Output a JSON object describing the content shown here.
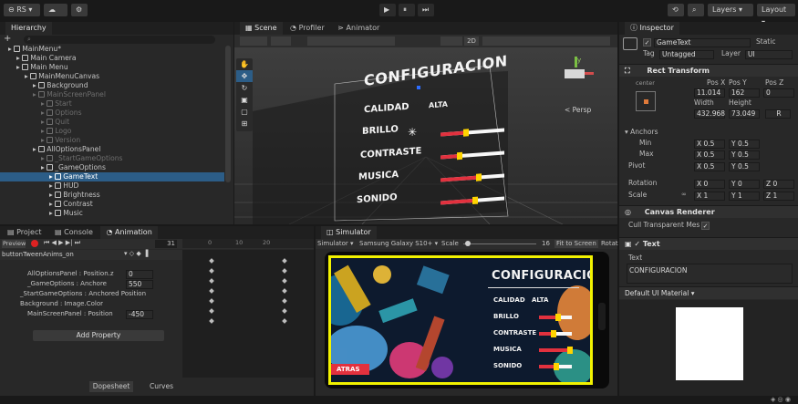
{
  "toolbar": {
    "account": "RS",
    "cloud": "☁",
    "gear": "⚙",
    "play": "▶",
    "pause": "⏸",
    "step": "⏭",
    "history": "⟲",
    "search": "🔍",
    "layers": "Layers",
    "layout": "Layout"
  },
  "hierarchy": {
    "title": "Hierarchy",
    "add": "+",
    "search_placeholder": "All",
    "rows": [
      {
        "label": "MainMenu*",
        "indent": 1,
        "state": "scene"
      },
      {
        "label": "Main Camera",
        "indent": 2,
        "state": "normal"
      },
      {
        "label": "Main Menu",
        "indent": 2,
        "state": "normal"
      },
      {
        "label": "MainMenuCanvas",
        "indent": 3,
        "state": "normal"
      },
      {
        "label": "Background",
        "indent": 4,
        "state": "normal"
      },
      {
        "label": "MainScreenPanel",
        "indent": 4,
        "state": "dim"
      },
      {
        "label": "Start",
        "indent": 5,
        "state": "dim"
      },
      {
        "label": "Options",
        "indent": 5,
        "state": "dim"
      },
      {
        "label": "Quit",
        "indent": 5,
        "state": "dim"
      },
      {
        "label": "Logo",
        "indent": 5,
        "state": "dim"
      },
      {
        "label": "Version",
        "indent": 5,
        "state": "dim"
      },
      {
        "label": "AllOptionsPanel",
        "indent": 4,
        "state": "normal"
      },
      {
        "label": "_StartGameOptions",
        "indent": 5,
        "state": "dim"
      },
      {
        "label": "_GameOptions",
        "indent": 5,
        "state": "normal"
      },
      {
        "label": "GameText",
        "indent": 6,
        "state": "sel"
      },
      {
        "label": "HUD",
        "indent": 6,
        "state": "normal"
      },
      {
        "label": "Brightness",
        "indent": 6,
        "state": "normal"
      },
      {
        "label": "Contrast",
        "indent": 6,
        "state": "normal"
      },
      {
        "label": "Music",
        "indent": 6,
        "state": "normal"
      }
    ]
  },
  "scene": {
    "tabs": [
      "Scene",
      "Profiler",
      "Animator"
    ],
    "mode_2d": "2D",
    "persp": "< Persp",
    "axis_y": "y",
    "axis_x": "x",
    "menu_title": "CONFIGURACION",
    "items": [
      {
        "label": "CALIDAD",
        "value": "ALTA"
      },
      {
        "label": "BRILLO",
        "value": ""
      },
      {
        "label": "CONTRASTE",
        "value": ""
      },
      {
        "label": "MUSICA",
        "value": ""
      },
      {
        "label": "SONIDO",
        "value": ""
      }
    ]
  },
  "bottom_left": {
    "tabs": [
      "Project",
      "Console",
      "Animation"
    ],
    "preview": "Preview",
    "frame": "31",
    "clip": "buttonTweenAnims_on",
    "ruler": [
      "0",
      "10",
      "20"
    ],
    "properties": [
      {
        "label": "AllOptionsPanel : Position.z",
        "value": "0"
      },
      {
        "label": "_GameOptions : Anchore",
        "value": "550"
      },
      {
        "label": "_StartGameOptions : Anchored Position",
        "value": ""
      },
      {
        "label": "Background : Image.Color",
        "value": ""
      },
      {
        "label": "MainScreenPanel : Position",
        "value": "-450"
      }
    ],
    "add_property": "Add Property",
    "dopesheet": "Dopesheet",
    "curves": "Curves"
  },
  "simulator": {
    "tab": "Simulator",
    "mode": "Simulator",
    "device": "Samsung Galaxy S10+",
    "scale_label": "Scale",
    "scale_value": "16",
    "fit": "Fit to Screen",
    "rotate": "Rotat",
    "menu_title": "CONFIGURACION",
    "items": [
      {
        "label": "CALIDAD",
        "value": "ALTA",
        "level": 0
      },
      {
        "label": "BRILLO",
        "value": "",
        "level": 0.5
      },
      {
        "label": "CONTRASTE",
        "value": "",
        "level": 0.35
      },
      {
        "label": "MUSICA",
        "value": "",
        "level": 0.85
      },
      {
        "label": "SONIDO",
        "value": "",
        "level": 0.45
      }
    ],
    "back": "ATRAS"
  },
  "inspector": {
    "title": "Inspector",
    "object_name": "GameText",
    "static": "Static",
    "tag_label": "Tag",
    "tag_value": "Untagged",
    "layer_label": "Layer",
    "layer_value": "UI",
    "rect": {
      "title": "Rect Transform",
      "anchor_h": "center",
      "anchor_v": "middle",
      "posx_label": "Pos X",
      "posy_label": "Pos Y",
      "posz_label": "Pos Z",
      "posx": "11.014",
      "posy": "162",
      "posz": "0",
      "width_label": "Width",
      "height_label": "Height",
      "width": "432.968",
      "height": "73.049",
      "r_btn": "R",
      "anchors": "Anchors",
      "min": "Min",
      "max": "Max",
      "pivot": "Pivot",
      "min_x": "0.5",
      "min_y": "0.5",
      "max_x": "0.5",
      "max_y": "0.5",
      "pivot_x": "0.5",
      "pivot_y": "0.5",
      "rotation": "Rotation",
      "scale": "Scale",
      "rot_x": "0",
      "rot_y": "0",
      "rot_z": "0",
      "scale_x": "1",
      "scale_y": "1",
      "scale_z": "1",
      "x": "X",
      "y": "Y",
      "z": "Z"
    },
    "canvas_renderer": {
      "title": "Canvas Renderer",
      "cull": "Cull Transparent Mes"
    },
    "text": {
      "title": "Text",
      "label": "Text",
      "value": "CONFIGURACION"
    },
    "material": "Default UI Material"
  },
  "status": {
    "icons": "◈ ◎ ◉"
  }
}
